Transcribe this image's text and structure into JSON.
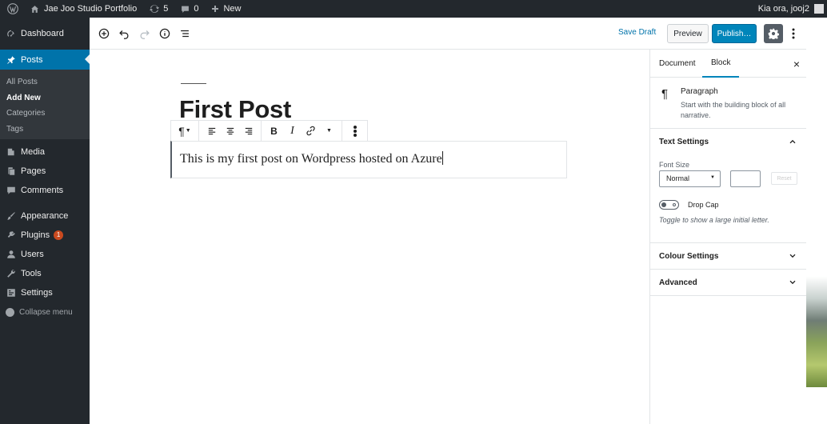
{
  "adminbar": {
    "site_name": "Jae Joo Studio Portfolio",
    "updates_count": "5",
    "comments_count": "0",
    "new_label": "New",
    "greeting": "Kia ora, jooj2"
  },
  "sidebar": {
    "dashboard": "Dashboard",
    "posts": "Posts",
    "submenu": [
      "All Posts",
      "Add New",
      "Categories",
      "Tags"
    ],
    "media": "Media",
    "pages": "Pages",
    "comments": "Comments",
    "appearance": "Appearance",
    "plugins": "Plugins",
    "plugins_badge": "1",
    "users": "Users",
    "tools": "Tools",
    "settings": "Settings",
    "collapse": "Collapse menu"
  },
  "header": {
    "save_draft": "Save Draft",
    "preview": "Preview",
    "publish": "Publish…"
  },
  "editor": {
    "title": "First Post",
    "paragraph": "This is my first post on Wordpress hosted on Azure"
  },
  "panel": {
    "tab_document": "Document",
    "tab_block": "Block",
    "close": "×",
    "block_name": "Paragraph",
    "block_desc": "Start with the building block of all narrative.",
    "text_settings": "Text Settings",
    "font_size_label": "Font Size",
    "font_size_value": "Normal",
    "reset": "Reset",
    "drop_cap": "Drop Cap",
    "drop_cap_help": "Toggle to show a large initial letter.",
    "colour_settings": "Colour Settings",
    "advanced": "Advanced"
  },
  "colors": {
    "admin_dark": "#23282d",
    "accent_blue": "#0073aa",
    "publish_blue": "#0085ba"
  }
}
